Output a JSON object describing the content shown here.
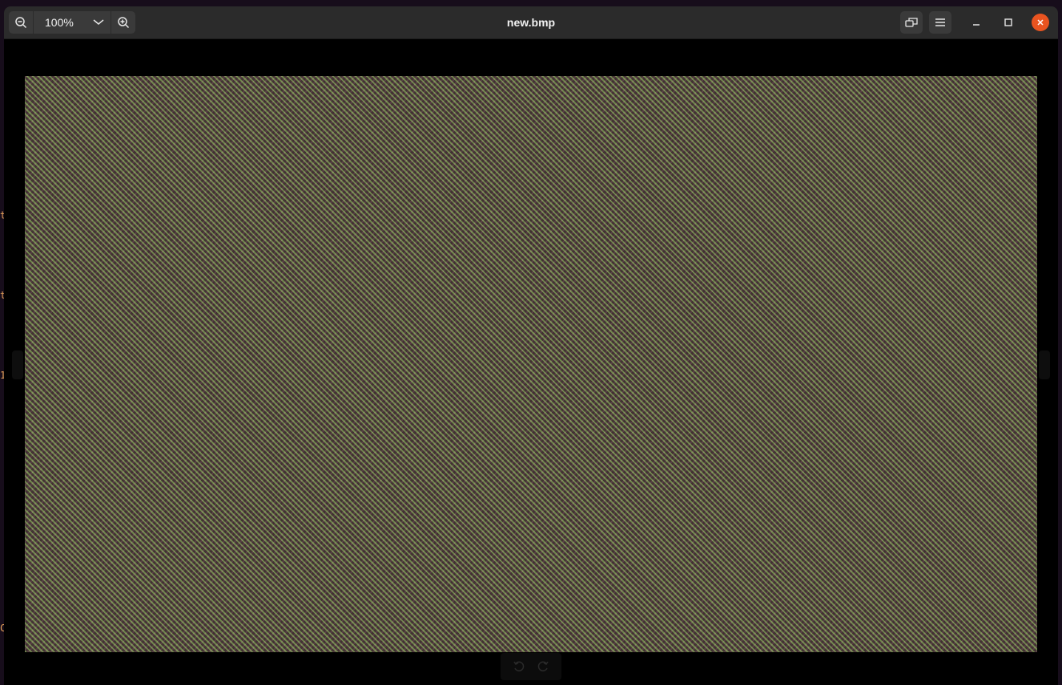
{
  "window": {
    "title": "new.bmp"
  },
  "headerbar": {
    "zoom_level": "100%",
    "icons": {
      "zoom_out": "zoom-out-icon",
      "zoom_dropdown": "chevron-down-icon",
      "zoom_in": "zoom-in-icon",
      "fullscreen": "window-restore-icon",
      "menu": "hamburger-menu-icon",
      "minimize": "minimize-icon",
      "maximize": "maximize-icon",
      "close": "close-icon"
    }
  },
  "toolbar": {
    "rotate_left": "rotate-left-icon",
    "rotate_right": "rotate-right-icon"
  },
  "background_glyphs": [
    "t",
    "t",
    "1",
    "C"
  ],
  "colors": {
    "close_button": "#e95420",
    "headerbar": "#2b2b2b",
    "canvas": "#000000"
  }
}
